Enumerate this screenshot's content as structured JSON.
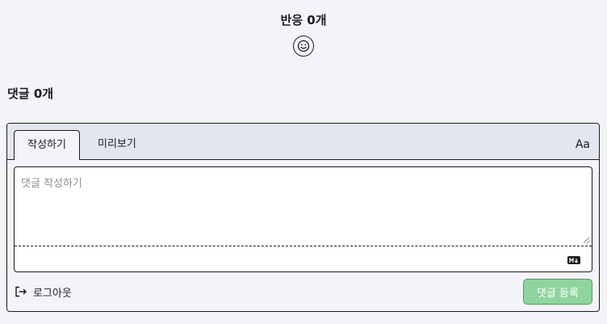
{
  "reactions": {
    "title": "반응 0개",
    "add_reaction_icon": "smiley-face-icon"
  },
  "comments": {
    "title": "댓글 0개",
    "tabs": [
      {
        "label": "작성하기",
        "active": true
      },
      {
        "label": "미리보기",
        "active": false
      }
    ],
    "font_toggle_label": "Aa",
    "input": {
      "placeholder": "댓글 작성하기",
      "value": ""
    },
    "markdown_icon": "markdown-icon",
    "logout_label": "로그아웃",
    "logout_icon": "sign-out-icon",
    "submit_label": "댓글 등록"
  },
  "colors": {
    "background": "#f4f4f8",
    "tabbar": "#e2e6ee",
    "submit_button": "#8fd49f",
    "text": "#1c1c1e",
    "placeholder": "#8a8f98"
  }
}
